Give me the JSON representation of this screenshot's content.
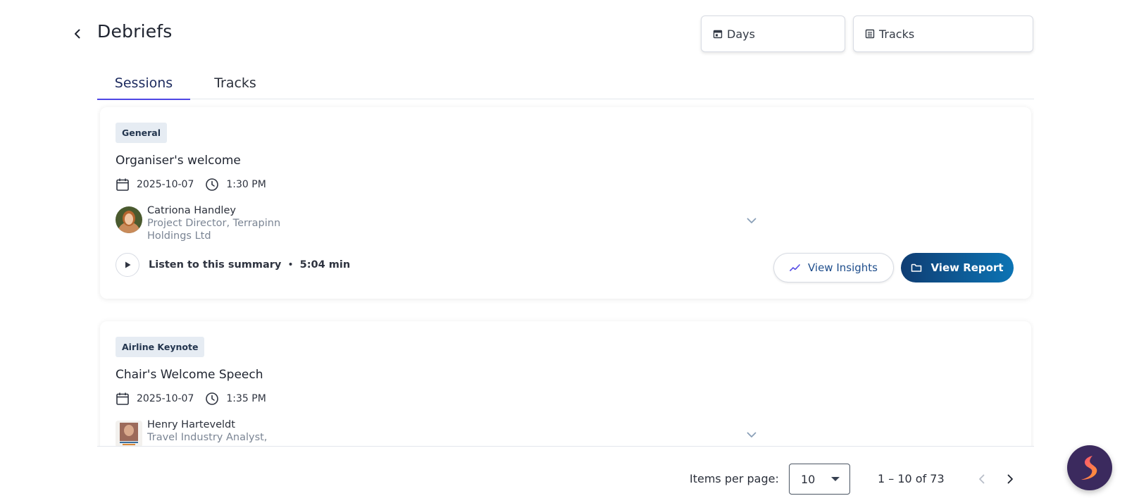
{
  "header": {
    "title": "Debriefs",
    "back_icon": "chevron-left-icon"
  },
  "filters": {
    "days_label": "Days",
    "tracks_label": "Tracks"
  },
  "tabs": [
    {
      "label": "Sessions",
      "active": true
    },
    {
      "label": "Tracks",
      "active": false
    }
  ],
  "sessions": [
    {
      "track": "General",
      "title": "Organiser's welcome",
      "date": "2025-10-07",
      "time": "1:30 PM",
      "speaker": {
        "name": "Catriona Handley",
        "role": "Project Director, Terrapinn Holdings Ltd"
      },
      "listen_label": "Listen to this summary",
      "separator": "•",
      "duration": "5:04 min",
      "insights_label": "View Insights",
      "report_label": "View Report"
    },
    {
      "track": "Airline Keynote",
      "title": "Chair's Welcome Speech",
      "date": "2025-10-07",
      "time": "1:35 PM",
      "speaker": {
        "name": "Henry Harteveldt",
        "role": "Travel Industry Analyst,"
      }
    }
  ],
  "pagination": {
    "items_per_page_label": "Items per page:",
    "items_per_page": "10",
    "range": "1 – 10 of 73"
  },
  "colors": {
    "accent": "#4f46e5",
    "primary_dark": "#0f3d73",
    "primary_light": "#0c74b4",
    "badge_bg": "#e6ecf3"
  }
}
